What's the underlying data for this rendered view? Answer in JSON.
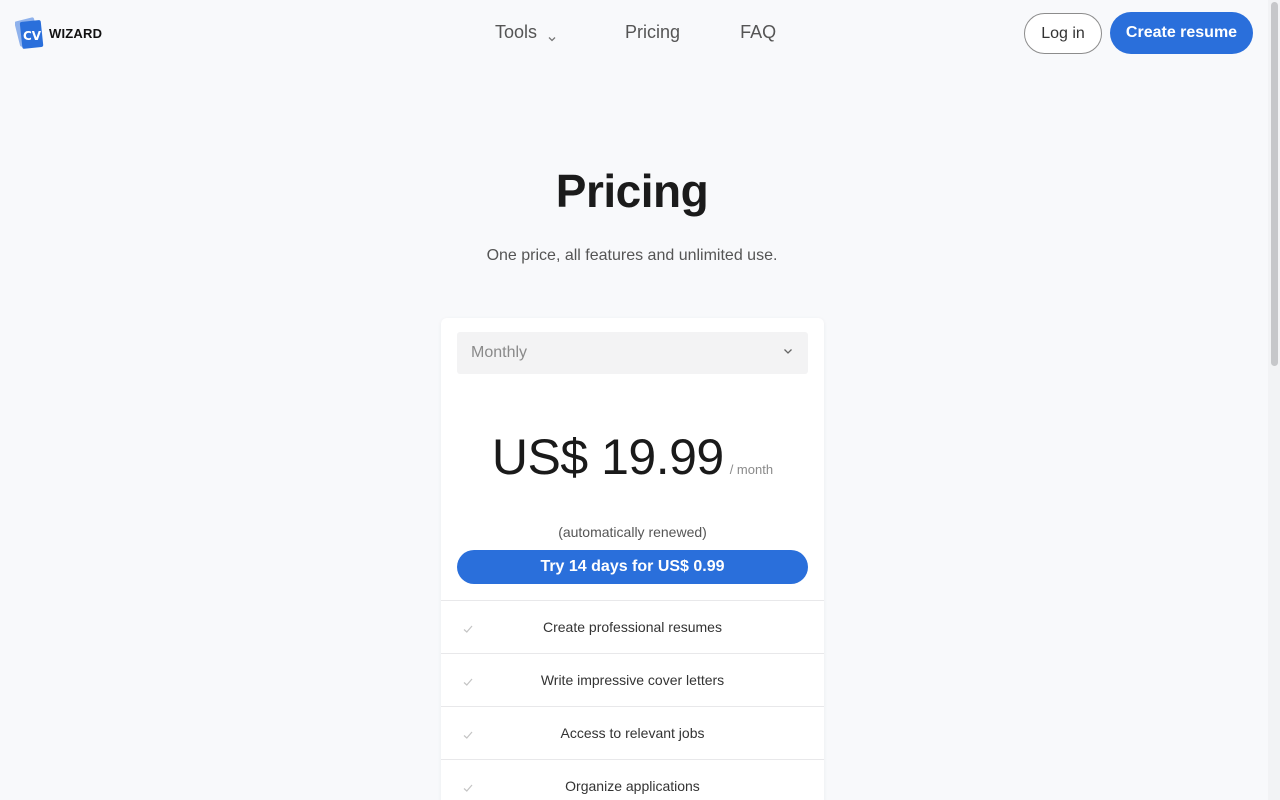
{
  "header": {
    "logo": {
      "mark_text": "CV",
      "wordmark": "WIZARD"
    },
    "nav": [
      {
        "label": "Tools",
        "has_dropdown": true
      },
      {
        "label": "Pricing",
        "has_dropdown": false
      },
      {
        "label": "FAQ",
        "has_dropdown": false
      }
    ],
    "login_label": "Log in",
    "create_label": "Create resume"
  },
  "hero": {
    "title": "Pricing",
    "subtitle": "One price, all features and unlimited use."
  },
  "card": {
    "billing_select": {
      "value": "Monthly"
    },
    "price": "US$ 19.99",
    "period": "/ month",
    "renewal_note": "(automatically renewed)",
    "trial_button": "Try 14 days for US$ 0.99",
    "features": [
      "Create professional resumes",
      "Write impressive cover letters",
      "Access to relevant jobs",
      "Organize applications"
    ]
  },
  "colors": {
    "primary": "#2a6fdb",
    "background": "#f8f9fb",
    "card": "#ffffff"
  },
  "icons": {
    "logo": "cv-cards-logo-icon",
    "dropdown": "chevron-down-icon",
    "feature": "check-icon"
  }
}
